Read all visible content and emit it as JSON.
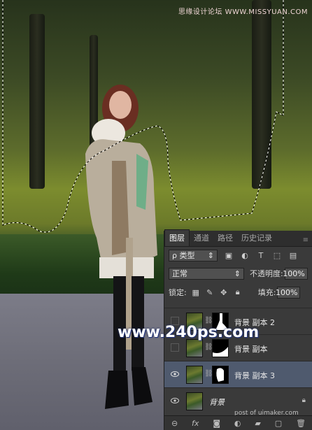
{
  "watermark_top": "思缘设计论坛 WWW.MISSYUAN.COM",
  "watermark_big": "www.240ps.com",
  "watermark_post": "post of uimaker.com",
  "panel": {
    "tabs": [
      "图层",
      "通道",
      "路径",
      "历史记录"
    ],
    "filter_label": "ρ 类型",
    "blend_mode": "正常",
    "opacity_label": "不透明度:",
    "opacity_value": "100%",
    "lock_label": "锁定:",
    "fill_label": "填充:",
    "fill_value": "100%",
    "layers": [
      {
        "name": "背景 副本 2",
        "visible": false,
        "selected": false
      },
      {
        "name": "背景 副本",
        "visible": false,
        "selected": false
      },
      {
        "name": "背景 副本 3",
        "visible": true,
        "selected": true
      },
      {
        "name": "背景",
        "visible": true,
        "selected": false
      }
    ],
    "footer_icons": [
      "link-icon",
      "fx-icon",
      "mask-icon",
      "adjustment-icon",
      "folder-icon",
      "new-layer-icon",
      "trash-icon"
    ]
  }
}
